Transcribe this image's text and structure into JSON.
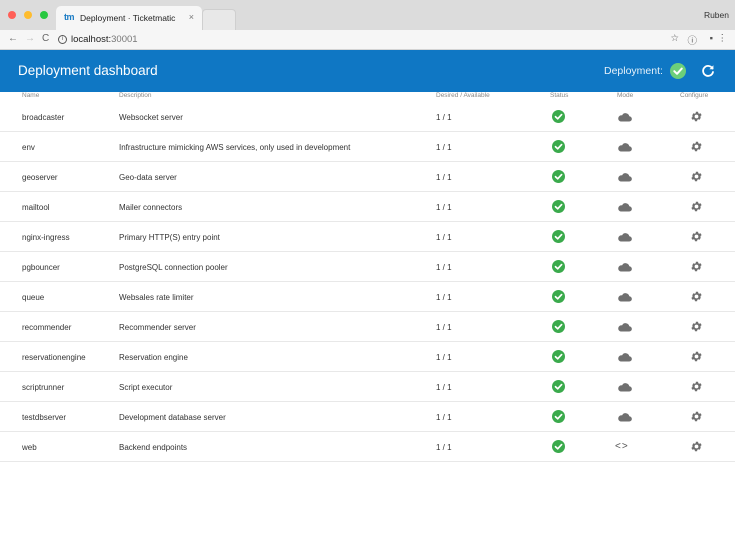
{
  "browser": {
    "tab_logo": "tm",
    "tab_title": "Deployment · Ticketmatic",
    "tab_close": "×",
    "user": "Ruben",
    "url_host": "localhost:",
    "url_port": "30001"
  },
  "app": {
    "title": "Deployment dashboard",
    "deployment_label": "Deployment:"
  },
  "table": {
    "headers": {
      "name": "Name",
      "description": "Description",
      "desired": "Desired / Available",
      "status": "Status",
      "mode": "Mode",
      "configure": "Configure"
    },
    "rows": [
      {
        "name": "broadcaster",
        "description": "Websocket server",
        "desired": "1 / 1",
        "mode": "cloud"
      },
      {
        "name": "env",
        "description": "Infrastructure mimicking AWS services, only used in development",
        "desired": "1 / 1",
        "mode": "cloud"
      },
      {
        "name": "geoserver",
        "description": "Geo-data server",
        "desired": "1 / 1",
        "mode": "cloud"
      },
      {
        "name": "mailtool",
        "description": "Mailer connectors",
        "desired": "1 / 1",
        "mode": "cloud"
      },
      {
        "name": "nginx-ingress",
        "description": "Primary HTTP(S) entry point",
        "desired": "1 / 1",
        "mode": "cloud"
      },
      {
        "name": "pgbouncer",
        "description": "PostgreSQL connection pooler",
        "desired": "1 / 1",
        "mode": "cloud"
      },
      {
        "name": "queue",
        "description": "Websales rate limiter",
        "desired": "1 / 1",
        "mode": "cloud"
      },
      {
        "name": "recommender",
        "description": "Recommender server",
        "desired": "1 / 1",
        "mode": "cloud"
      },
      {
        "name": "reservationengine",
        "description": "Reservation engine",
        "desired": "1 / 1",
        "mode": "cloud"
      },
      {
        "name": "scriptrunner",
        "description": "Script executor",
        "desired": "1 / 1",
        "mode": "cloud"
      },
      {
        "name": "testdbserver",
        "description": "Development database server",
        "desired": "1 / 1",
        "mode": "cloud"
      },
      {
        "name": "web",
        "description": "Backend endpoints",
        "desired": "1 / 1",
        "mode": "code",
        "mode_glyph": "<>"
      }
    ]
  },
  "colors": {
    "header_bg": "#0f77c4",
    "status_ok": "#3aaa4c",
    "icon_gray": "#6f6f6f"
  }
}
